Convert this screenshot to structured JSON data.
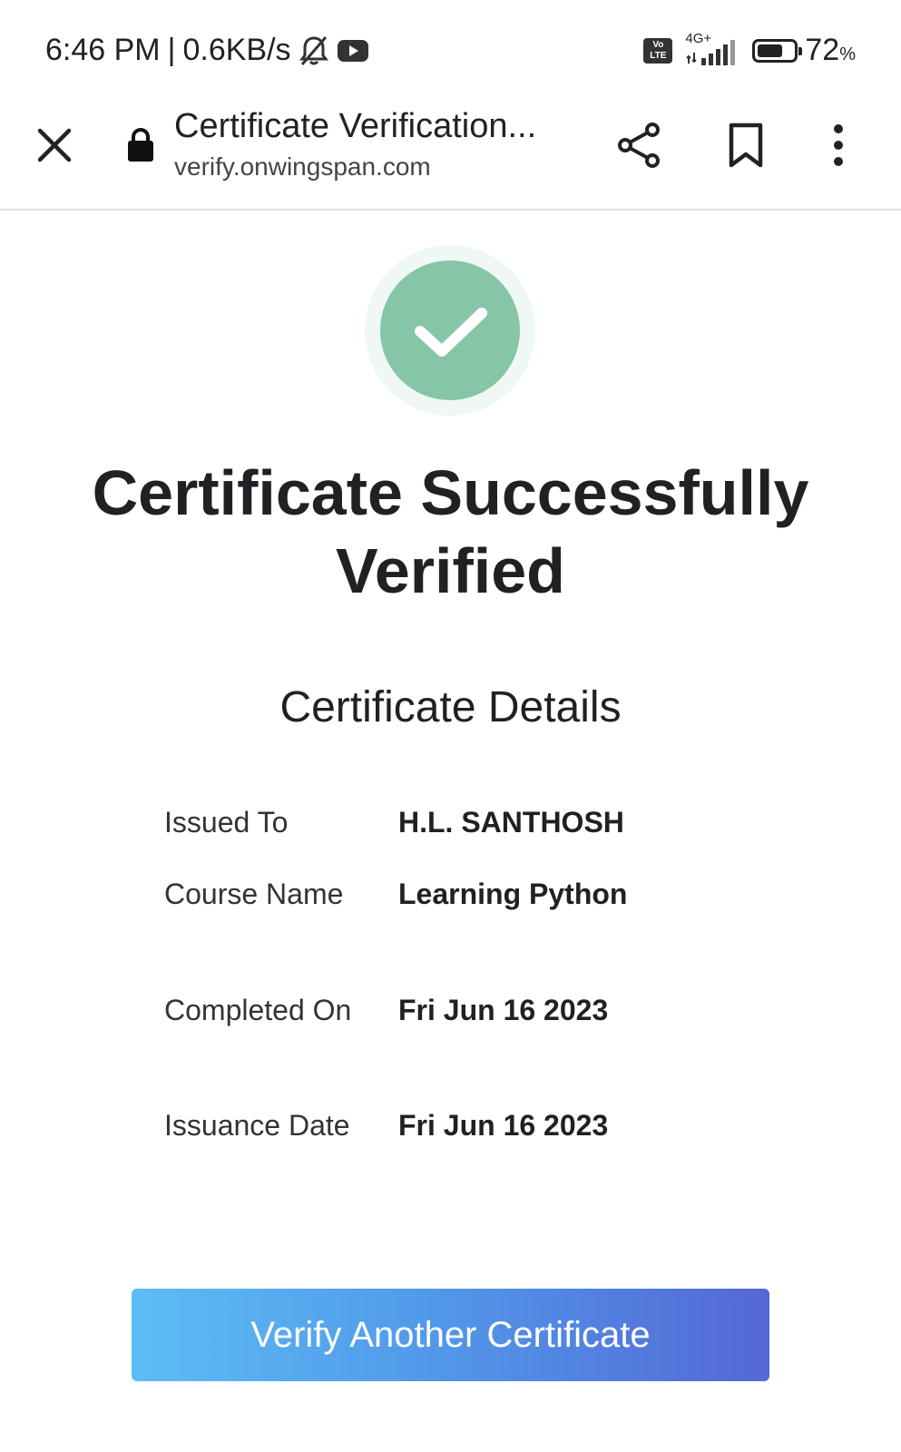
{
  "status_bar": {
    "time": "6:46 PM",
    "separator": "|",
    "net_speed": "0.6KB/s",
    "volte_top": "Vo",
    "volte_bottom": "LTE",
    "network_type": "4G+",
    "battery_percent": "72",
    "battery_unit": "%",
    "battery_level": 0.72
  },
  "browser": {
    "page_title": "Certificate Verification...",
    "url": "verify.onwingspan.com"
  },
  "main": {
    "headline_line1": "Certificate Successfully",
    "headline_line2": "Verified",
    "details_title": "Certificate Details",
    "details": [
      {
        "label": "Issued To",
        "value": "H.L. SANTHOSH"
      },
      {
        "label": "Course Name",
        "value": "Learning Python"
      },
      {
        "label": "Completed On",
        "value": "Fri Jun 16 2023"
      },
      {
        "label": "Issuance Date",
        "value": "Fri Jun 16 2023"
      }
    ],
    "verify_button_label": "Verify Another Certificate"
  },
  "colors": {
    "success_green": "#86c5a6",
    "success_ring": "#eff8f5",
    "button_gradient_start": "#5cbdf5",
    "button_gradient_end": "#5567d6"
  }
}
